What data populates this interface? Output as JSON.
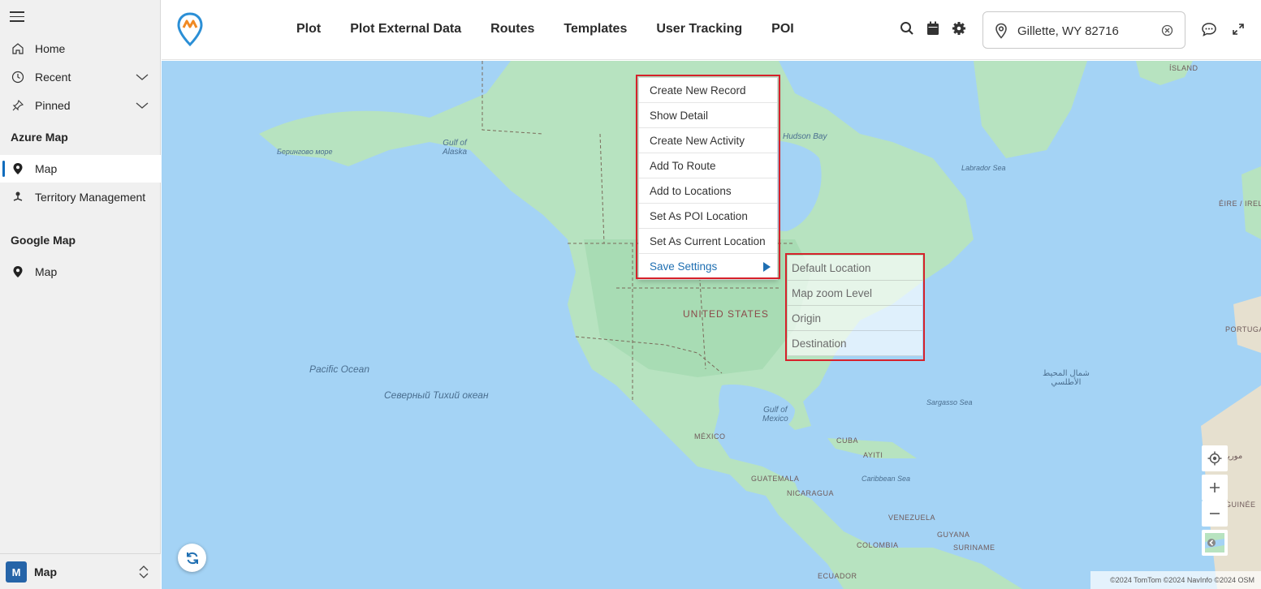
{
  "sidebar": {
    "items": [
      {
        "label": "Home"
      },
      {
        "label": "Recent"
      },
      {
        "label": "Pinned"
      }
    ],
    "groups": [
      {
        "title": "Azure Map",
        "items": [
          {
            "label": "Map"
          },
          {
            "label": "Territory Management"
          }
        ]
      },
      {
        "title": "Google Map",
        "items": [
          {
            "label": "Map"
          }
        ]
      }
    ],
    "area": {
      "badge": "M",
      "label": "Map"
    }
  },
  "header": {
    "menu": [
      "Plot",
      "Plot External Data",
      "Routes",
      "Templates",
      "User Tracking",
      "POI"
    ],
    "location_value": "Gillette, WY 82716"
  },
  "context_menu": {
    "items": [
      "Create New Record",
      "Show Detail",
      "Create New Activity",
      "Add To Route",
      "Add to Locations",
      "Set As POI Location",
      "Set As Current Location"
    ],
    "submenu_label": "Save Settings"
  },
  "submenu": {
    "items": [
      "Default Location",
      "Map zoom Level",
      "Origin",
      "Destination"
    ]
  },
  "map": {
    "labels": {
      "bering": "Беринговo море",
      "alaska_gulf": "Gulf of\nAlaska",
      "hudson": "Hudson Bay",
      "labrador": "Labrador Sea",
      "island": "ÍSLAND",
      "eire": "ÉIRE / IRELAND",
      "portugal": "PORTUGAL",
      "usa": "UNITED STATES",
      "pacific": "Pacific Ocean",
      "pacific_ru": "Северный Тихий океан",
      "mexico_gulf": "Gulf of\nMexico",
      "mexico": "MÉXICO",
      "cuba": "CUBA",
      "ayiti": "AYITI",
      "guatemala": "GUATEMALA",
      "nicaragua": "NICARAGUA",
      "caribbean": "Caribbean Sea",
      "sargasso": "Sargasso Sea",
      "atlantic_ar": "شمال المحيط\nالأطلسي",
      "venezuela": "VENEZUELA",
      "guyana": "GUYANA",
      "suriname": "SURINAME",
      "colombia": "COLOMBIA",
      "ecuador": "ECUADOR",
      "guinee": "GUINÉE",
      "syria": "موريتا"
    },
    "attribution": "©2024 TomTom  ©2024 NavInfo  ©2024 OSM"
  },
  "colors": {
    "land": "#b7e3c0",
    "forest": "#9fd8ab",
    "water": "#a4d3f5",
    "highlight": "#d6212b",
    "accent": "#1f6fb2"
  }
}
